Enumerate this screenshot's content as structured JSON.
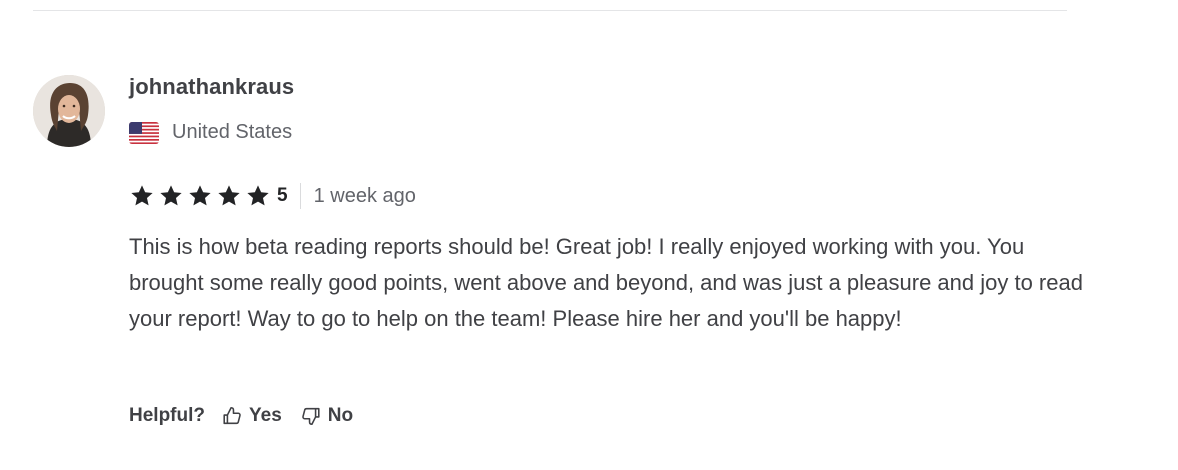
{
  "review": {
    "username": "johnathankraus",
    "country": "United States",
    "rating": "5",
    "time_ago": "1 week ago",
    "text": "This is how beta reading reports should be! Great job! I really enjoyed working with you. You brought some really good points, went above and beyond, and was just a pleasure and joy to read your report! Way to go to help on the team! Please hire her and you'll be happy!",
    "stars_filled": 5,
    "star_color": "#222325"
  },
  "helpful": {
    "label": "Helpful?",
    "yes_label": "Yes",
    "no_label": "No",
    "yes_icon": "thumbs-up-icon",
    "no_icon": "thumbs-down-icon"
  },
  "colors": {
    "text_primary": "#404145",
    "text_secondary": "#62646a",
    "divider": "#e4e5e7"
  }
}
